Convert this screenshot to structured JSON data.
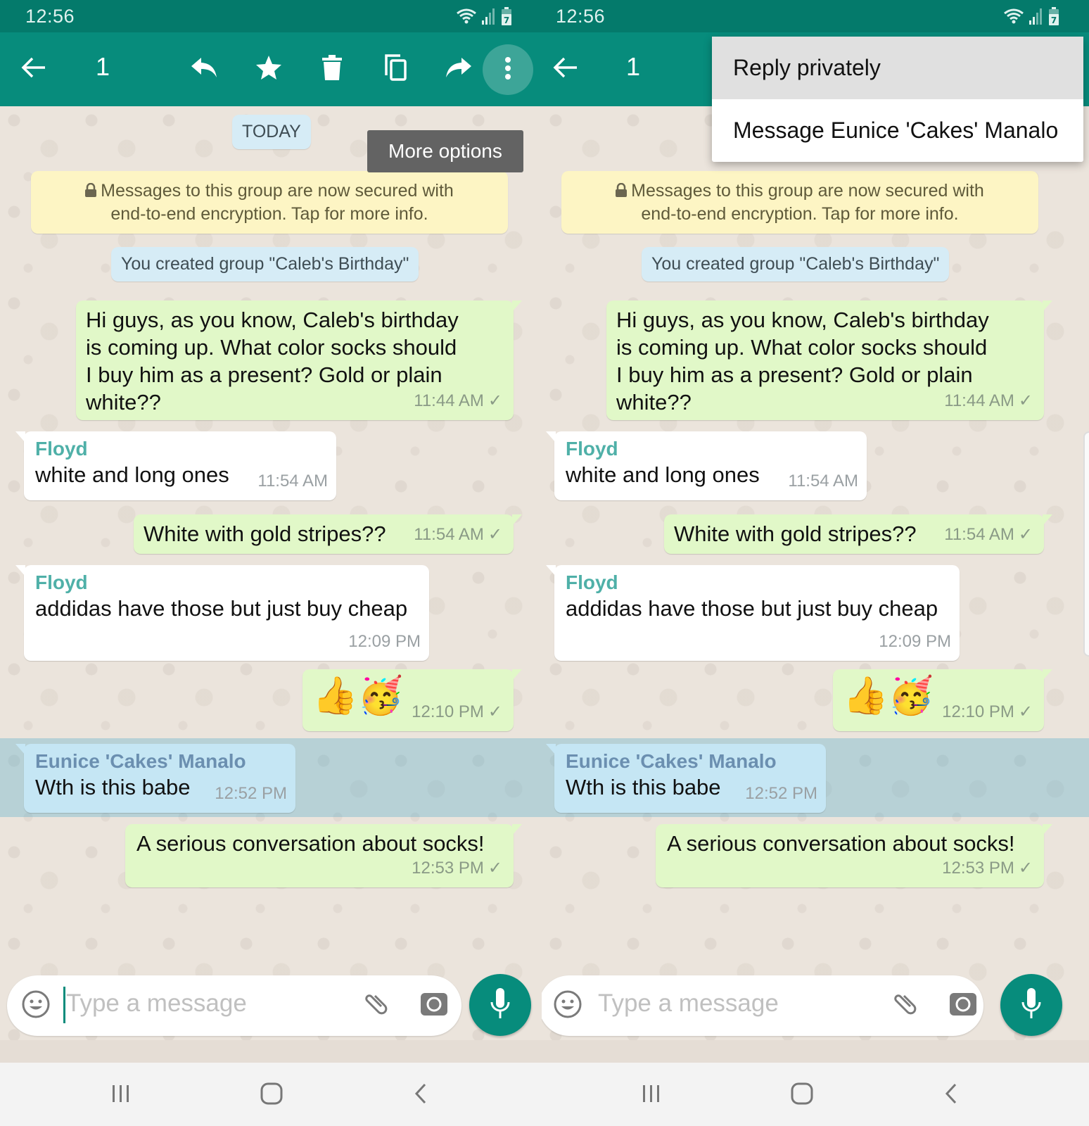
{
  "screens": [
    {
      "id": "left",
      "status_bar": {
        "time": "12:56",
        "battery_level": "7"
      },
      "app_bar": {
        "selection_count": "1",
        "actions": [
          "back",
          "reply",
          "star",
          "delete",
          "copy",
          "forward",
          "more-options"
        ]
      },
      "tooltip": "More options",
      "chat": {
        "date_label": "TODAY",
        "encryption_notice_line1": "Messages to this group are now secured with",
        "encryption_notice_line2": "end-to-end encryption. Tap for more info.",
        "system_message": "You created group \"Caleb's Birthday\"",
        "messages": [
          {
            "direction": "out",
            "lines": [
              "Hi guys, as you know, Caleb's birthday",
              "is coming up. What color socks should",
              "I buy him as a present? Gold or plain",
              "white??"
            ],
            "time": "11:44 AM",
            "status": "sent"
          },
          {
            "direction": "in",
            "sender": "Floyd",
            "text": "white and long ones",
            "time": "11:54 AM"
          },
          {
            "direction": "out",
            "text": "White with gold stripes??",
            "time": "11:54 AM",
            "status": "sent"
          },
          {
            "direction": "in",
            "sender": "Floyd",
            "text": "addidas have those but just buy cheap",
            "time": "12:09 PM"
          },
          {
            "direction": "out",
            "text": "👍🥳",
            "time": "12:10 PM",
            "status": "sent"
          },
          {
            "direction": "in",
            "sender": "Eunice 'Cakes' Manalo",
            "text": "Wth is this babe",
            "time": "12:52 PM",
            "selected": true
          },
          {
            "direction": "out",
            "text": "A serious conversation about socks!",
            "time": "12:53 PM",
            "status": "sent"
          }
        ]
      },
      "composer": {
        "placeholder": "Type a message",
        "value": ""
      }
    },
    {
      "id": "right",
      "status_bar": {
        "time": "12:56",
        "battery_level": "7"
      },
      "app_bar": {
        "selection_count": "1"
      },
      "overflow_menu": {
        "items": [
          {
            "label": "Reply privately",
            "highlighted": true
          },
          {
            "label": "Message Eunice 'Cakes' Manalo",
            "highlighted": false
          }
        ]
      },
      "chat": {
        "encryption_notice_line1": "Messages to this group are now secured with",
        "encryption_notice_line2": "end-to-end encryption. Tap for more info.",
        "system_message": "You created group \"Caleb's Birthday\"",
        "messages": [
          {
            "direction": "out",
            "lines": [
              "Hi guys, as you know, Caleb's birthday",
              "is coming up. What color socks should",
              "I buy him as a present? Gold or plain",
              "white??"
            ],
            "time": "11:44 AM",
            "status": "sent"
          },
          {
            "direction": "in",
            "sender": "Floyd",
            "text": "white and long ones",
            "time": "11:54 AM"
          },
          {
            "direction": "out",
            "text": "White with gold stripes??",
            "time": "11:54 AM",
            "status": "sent"
          },
          {
            "direction": "in",
            "sender": "Floyd",
            "text": "addidas have those but just buy cheap",
            "time": "12:09 PM"
          },
          {
            "direction": "out",
            "text": "👍🥳",
            "time": "12:10 PM",
            "status": "sent"
          },
          {
            "direction": "in",
            "sender": "Eunice 'Cakes' Manalo",
            "text": "Wth is this babe",
            "time": "12:52 PM",
            "selected": true
          },
          {
            "direction": "out",
            "text": "A serious conversation about socks!",
            "time": "12:53 PM",
            "status": "sent"
          }
        ]
      },
      "composer": {
        "placeholder": "Type a message",
        "value": ""
      }
    }
  ],
  "colors": {
    "status_bar": "#047a6b",
    "app_bar": "#078c7c",
    "outgoing_bubble": "#e1f8c8",
    "incoming_bubble": "#ffffff",
    "selected_bubble": "#c5e6f4",
    "floyd_name": "#4fb0a8",
    "eunice_name": "#6b8fb0",
    "encryption_notice": "#fdf5c4"
  }
}
